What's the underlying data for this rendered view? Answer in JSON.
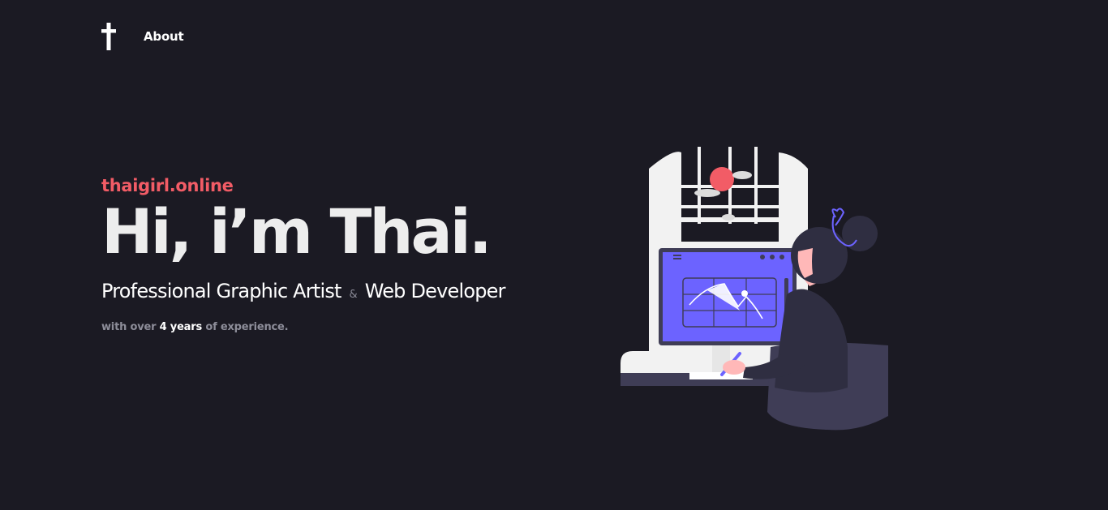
{
  "nav": {
    "logo_icon": "cross-icon",
    "about_label": "About"
  },
  "hero": {
    "site_name": "thaigirl.online",
    "headline": "Hi, i’m Thai.",
    "role_primary": "Professional Graphic Artist",
    "role_amp": "&",
    "role_secondary": "Web Developer",
    "experience_prefix": "with over",
    "experience_years": "4 years",
    "experience_suffix": "of experience."
  },
  "illustration": {
    "name": "woman-drawing-at-monitor-illustration"
  },
  "colors": {
    "background": "#1b1a23",
    "accent": "#f25c66",
    "monitor_screen": "#6c63ff",
    "text_primary": "#ffffff",
    "text_muted": "#8d8d99"
  }
}
